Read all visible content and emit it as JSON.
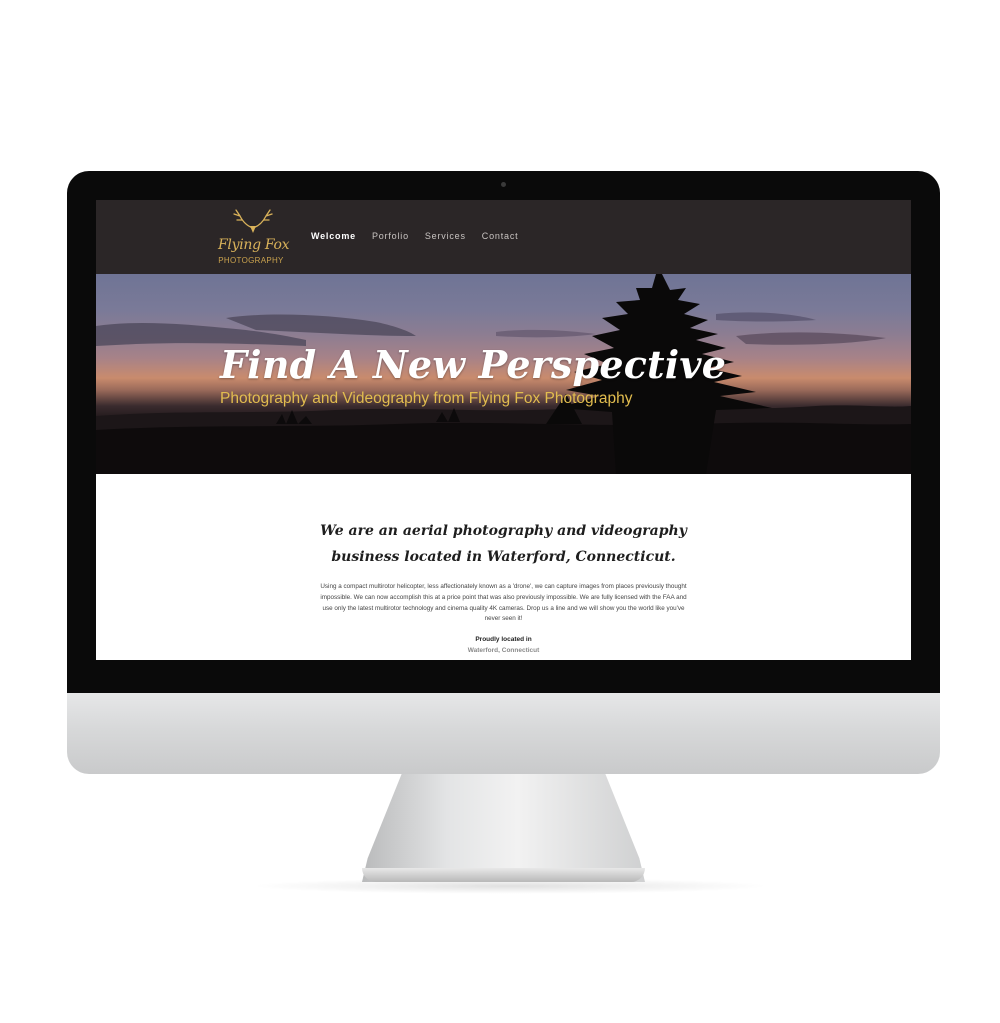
{
  "site": {
    "logo": {
      "title": "Flying Fox",
      "subtitle": "PHOTOGRAPHY"
    },
    "nav": {
      "items": [
        {
          "label": "Welcome",
          "active": true
        },
        {
          "label": "Porfolio",
          "active": false
        },
        {
          "label": "Services",
          "active": false
        },
        {
          "label": "Contact",
          "active": false
        }
      ]
    },
    "hero": {
      "title": "Find A New Perspective",
      "subtitle": "Photography and Videography from Flying Fox Photography"
    },
    "content": {
      "heading": "We are an aerial photography and videography business located in Waterford, Connecticut.",
      "body": "Using a compact multirotor helicopter, less affectionately known as a 'drone', we can capture images from places previously thought impossible.  We can now accomplish this at a price point that was also previously impossible.  We are fully licensed with the FAA and use only the latest multirotor technology and cinema quality 4K cameras.  Drop us a line and we will show you the world like you've never seen it!",
      "located_label": "Proudly located in",
      "located_value": "Waterford, Connecticut"
    }
  },
  "colors": {
    "header_bg": "#2b2627",
    "accent_gold": "#d9b25a",
    "subtitle_gold": "#e2bd4f"
  }
}
